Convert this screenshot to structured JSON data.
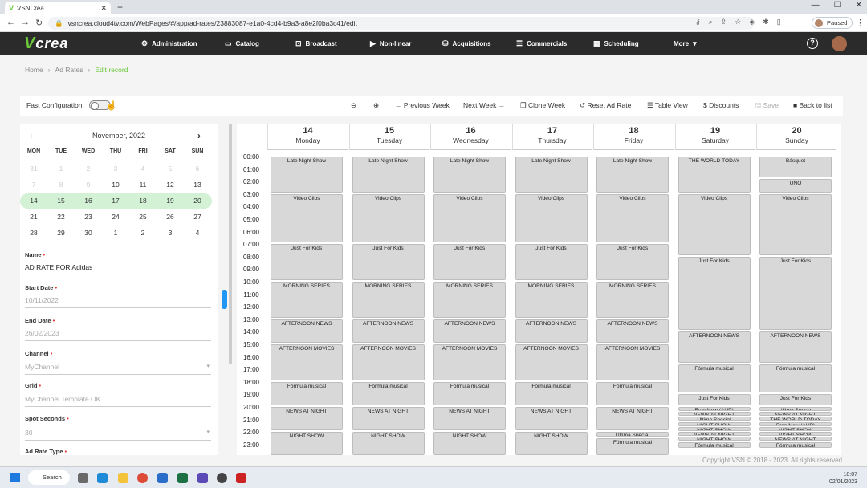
{
  "browser": {
    "tab_title": "VSNCrea",
    "url": "vsncrea.cloud4tv.com/WebPages/#/app/ad-rates/23883087-e1a0-4cd4-b9a3-a8e2f0ba3c41/edit",
    "profile": "Paused"
  },
  "app": {
    "logo": "crea",
    "menu": [
      {
        "label": "Administration",
        "icon": "gear-icon"
      },
      {
        "label": "Catalog",
        "icon": "folder-icon"
      },
      {
        "label": "Broadcast",
        "icon": "cast-icon"
      },
      {
        "label": "Non-linear",
        "icon": "play-icon"
      },
      {
        "label": "Acquisitions",
        "icon": "basket-icon"
      },
      {
        "label": "Commercials",
        "icon": "list-icon"
      },
      {
        "label": "Scheduling",
        "icon": "calendar-icon"
      },
      {
        "label": "More",
        "icon": "caret-down-icon"
      }
    ]
  },
  "breadcrumb": [
    "Home",
    "Ad Rates",
    "Edit record"
  ],
  "toolbar": {
    "fast_config": "Fast Configuration",
    "prev_week": "← Previous Week",
    "next_week": "Next Week →",
    "clone_week": "Clone Week",
    "reset": "Reset Ad Rate",
    "table_view": "Table View",
    "discounts": "Discounts",
    "save": "Save",
    "back": "Back to list"
  },
  "calendar": {
    "month": "November, 2022",
    "dow": [
      "MON",
      "TUE",
      "WED",
      "THU",
      "FRI",
      "SAT",
      "SUN"
    ],
    "weeks": [
      [
        "31",
        "1",
        "2",
        "3",
        "4",
        "5",
        "6"
      ],
      [
        "7",
        "8",
        "9",
        "10",
        "11",
        "12",
        "13"
      ],
      [
        "14",
        "15",
        "16",
        "17",
        "18",
        "19",
        "20"
      ],
      [
        "21",
        "22",
        "23",
        "24",
        "25",
        "26",
        "27"
      ],
      [
        "28",
        "29",
        "30",
        "1",
        "2",
        "3",
        "4"
      ]
    ]
  },
  "form": {
    "name_label": "Name",
    "name_value": "AD RATE FOR Adidas",
    "start_label": "Start Date",
    "start_value": "10/11/2022",
    "end_label": "End Date",
    "end_value": "26/02/2023",
    "channel_label": "Channel",
    "channel_value": "MyChannel",
    "grid_label": "Grid",
    "grid_value": "MyChannel Template OK",
    "spot_label": "Spot Seconds",
    "spot_value": "30",
    "type_label": "Ad Rate Type"
  },
  "week": {
    "days": [
      {
        "n": "14",
        "w": "Monday"
      },
      {
        "n": "15",
        "w": "Tuesday"
      },
      {
        "n": "16",
        "w": "Wednesday"
      },
      {
        "n": "17",
        "w": "Thursday"
      },
      {
        "n": "18",
        "w": "Friday"
      },
      {
        "n": "19",
        "w": "Saturday"
      },
      {
        "n": "20",
        "w": "Sunday"
      }
    ],
    "hours": [
      "00:00",
      "01:00",
      "02:00",
      "03:00",
      "04:00",
      "05:00",
      "06:00",
      "07:00",
      "08:00",
      "09:00",
      "10:00",
      "11:00",
      "12:00",
      "13:00",
      "14:00",
      "15:00",
      "16:00",
      "17:00",
      "18:00",
      "19:00",
      "20:00",
      "21:00",
      "22:00",
      "23:00"
    ],
    "weekday_events": [
      {
        "t": "Late Night Show",
        "s": 0,
        "e": 3
      },
      {
        "t": "Video Clips",
        "s": 3,
        "e": 7
      },
      {
        "t": "Just For Kids",
        "s": 7,
        "e": 10
      },
      {
        "t": "MORNING SERIES",
        "s": 10,
        "e": 13
      },
      {
        "t": "AFTERNOON NEWS",
        "s": 13,
        "e": 15
      },
      {
        "t": "AFTERNOON MOVIES",
        "s": 15,
        "e": 18
      },
      {
        "t": "Fórmula musical",
        "s": 18,
        "e": 20
      },
      {
        "t": "NEWS AT NIGHT",
        "s": 20,
        "e": 22
      },
      {
        "t": "NIGHT SHOW",
        "s": 22,
        "e": 24
      }
    ],
    "friday_late": [
      {
        "t": "Ultima Special",
        "s": 22,
        "e": 22.5
      },
      {
        "t": "Fórmula musical",
        "s": 22.5,
        "e": 24
      }
    ],
    "saturday_events": [
      {
        "t": "THE WORLD TODAY",
        "s": 0,
        "e": 3
      },
      {
        "t": "Video Clips",
        "s": 3,
        "e": 8
      },
      {
        "t": "Just For Kids",
        "s": 8,
        "e": 14
      },
      {
        "t": "AFTERNOON NEWS",
        "s": 14,
        "e": 16.6
      },
      {
        "t": "Fórmula musical",
        "s": 16.6,
        "e": 19
      },
      {
        "t": "Just For Kids",
        "s": 19,
        "e": 20
      },
      {
        "t": "Fran New (AUP)",
        "s": 20,
        "e": 20.4
      },
      {
        "t": "NEWS AT NIGHT",
        "s": 20.4,
        "e": 20.8
      },
      {
        "t": "Ultima Special",
        "s": 20.8,
        "e": 21.2
      },
      {
        "t": "NIGHT SHOW",
        "s": 21.2,
        "e": 21.6
      },
      {
        "t": "NIGHT SHOW",
        "s": 21.6,
        "e": 22
      },
      {
        "t": "NEWS AT NIGHT",
        "s": 22,
        "e": 22.4
      },
      {
        "t": "NIGHT SHOW",
        "s": 22.4,
        "e": 22.8
      },
      {
        "t": "Fórmula musical",
        "s": 22.8,
        "e": 23.4
      }
    ],
    "sunday_events": [
      {
        "t": "Básquet",
        "s": 0,
        "e": 1.8
      },
      {
        "t": "UNO",
        "s": 1.8,
        "e": 3
      },
      {
        "t": "Video Clips",
        "s": 3,
        "e": 8
      },
      {
        "t": "Just For Kids",
        "s": 8,
        "e": 14
      },
      {
        "t": "AFTERNOON NEWS",
        "s": 14,
        "e": 16.6
      },
      {
        "t": "Fórmula musical",
        "s": 16.6,
        "e": 19
      },
      {
        "t": "Just For Kids",
        "s": 19,
        "e": 20
      },
      {
        "t": "Ultima Special",
        "s": 20,
        "e": 20.4
      },
      {
        "t": "NEWS AT NIGHT",
        "s": 20.4,
        "e": 20.8
      },
      {
        "t": "THE WORLD TODAY",
        "s": 20.8,
        "e": 21.2
      },
      {
        "t": "Fran New (AUP)",
        "s": 21.2,
        "e": 21.6
      },
      {
        "t": "NIGHT SHOW",
        "s": 21.6,
        "e": 22
      },
      {
        "t": "NIGHT SHOW",
        "s": 22,
        "e": 22.4
      },
      {
        "t": "NEWS AT NIGHT",
        "s": 22.4,
        "e": 22.8
      },
      {
        "t": "Fórmula musical",
        "s": 22.8,
        "e": 23.4
      }
    ]
  },
  "footer": "Copyright VSN © 2018 - 2023. All rights reserved.",
  "taskbar": {
    "search": "Search",
    "time": "18:07",
    "date": "02/01/2023"
  },
  "colors": {
    "accent": "#6cc83a",
    "nav": "#2b2b2b",
    "week_highlight": "#d3f1d5",
    "event": "#d8d8d8"
  }
}
